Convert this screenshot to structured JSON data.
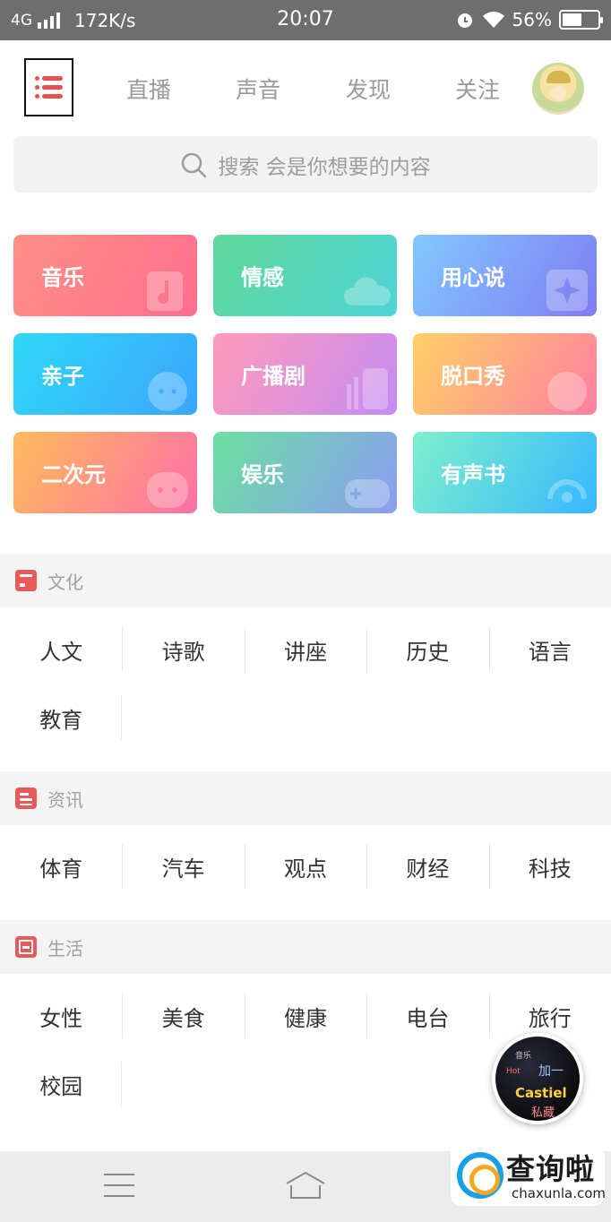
{
  "status_bar": {
    "network": "4G",
    "speed": "172K/s",
    "time": "20:07",
    "battery": "56%",
    "battery_level": 0.56
  },
  "header": {
    "tabs": [
      "直播",
      "声音",
      "发现",
      "关注"
    ]
  },
  "search": {
    "placeholder": "搜索 会是你想要的内容"
  },
  "categories": [
    {
      "label": "音乐",
      "colors": [
        "#ff8f87",
        "#ff6f8d"
      ],
      "icon": "music-note-icon"
    },
    {
      "label": "情感",
      "colors": [
        "#5fd99a",
        "#4fd3d6"
      ],
      "icon": "cloud-icon"
    },
    {
      "label": "用心说",
      "colors": [
        "#82c8ff",
        "#7f7cf2"
      ],
      "icon": "sparkle-icon"
    },
    {
      "label": "亲子",
      "colors": [
        "#2fd8f6",
        "#3ba5ff"
      ],
      "icon": "child-face-icon"
    },
    {
      "label": "广播剧",
      "colors": [
        "#ff9ab9",
        "#c58cf3"
      ],
      "icon": "radio-icon"
    },
    {
      "label": "脱口秀",
      "colors": [
        "#ffd166",
        "#ff7fa1"
      ],
      "icon": "face-icon"
    },
    {
      "label": "二次元",
      "colors": [
        "#ffbb5c",
        "#ff6fa8"
      ],
      "icon": "robot-icon"
    },
    {
      "label": "娱乐",
      "colors": [
        "#6be0a0",
        "#8b9cf3"
      ],
      "icon": "gamepad-icon"
    },
    {
      "label": "有声书",
      "colors": [
        "#7df0cc",
        "#36b8ff"
      ],
      "icon": "headset-icon"
    }
  ],
  "sections": [
    {
      "title": "文化",
      "icon": "book-icon",
      "rows": [
        [
          "人文",
          "诗歌",
          "讲座",
          "历史",
          "语言"
        ],
        [
          "教育"
        ]
      ]
    },
    {
      "title": "资讯",
      "icon": "news-icon",
      "rows": [
        [
          "体育",
          "汽车",
          "观点",
          "财经",
          "科技"
        ]
      ]
    },
    {
      "title": "生活",
      "icon": "life-icon",
      "rows": [
        [
          "女性",
          "美食",
          "健康",
          "电台",
          "旅行"
        ],
        [
          "校园"
        ]
      ]
    }
  ],
  "player": {
    "words": [
      "加一",
      "Castiel",
      "私藏",
      "音乐",
      "Hot"
    ]
  },
  "watermark": {
    "title": "查询啦",
    "url": "chaxunla.com"
  },
  "colors": {
    "accent": "#e8514f",
    "section_bg": "#f4f4f4",
    "bottom_bar": "#ececec"
  }
}
